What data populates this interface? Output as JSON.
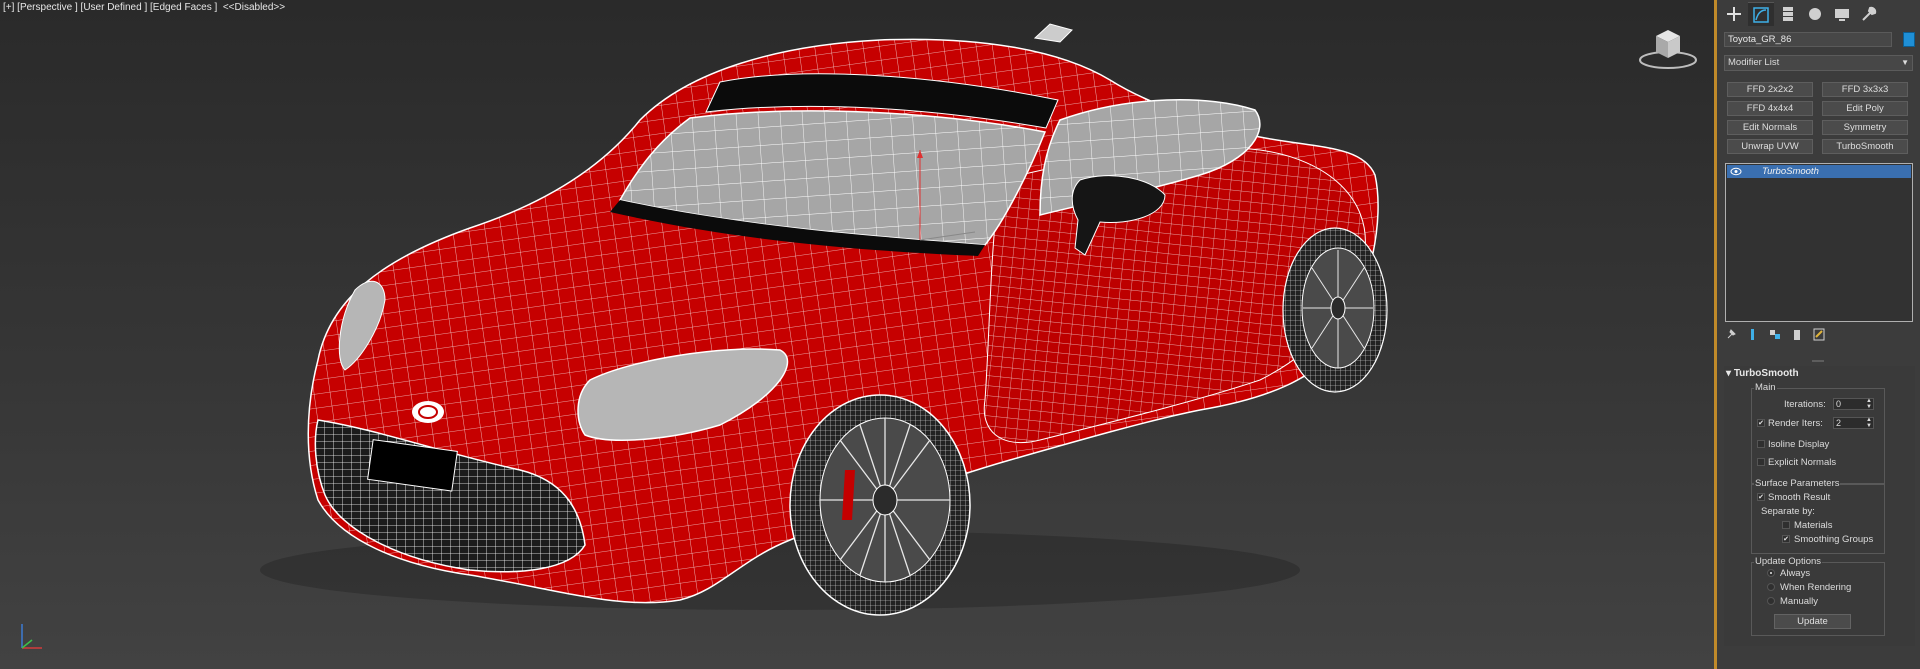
{
  "viewport": {
    "label": "[+] [Perspective ] [User Defined ] [Edged Faces ]  <<Disabled>>",
    "axis_labels": {
      "x": "x",
      "y": "y",
      "z": "z"
    }
  },
  "command_panel": {
    "tabs": [
      {
        "icon": "create-icon"
      },
      {
        "icon": "modify-icon"
      },
      {
        "icon": "hierarchy-icon"
      },
      {
        "icon": "motion-icon"
      },
      {
        "icon": "display-icon"
      },
      {
        "icon": "utilities-icon"
      }
    ],
    "object_name": "Toyota_GR_86",
    "object_color": "#1f8fd6",
    "modifier_list": "Modifier List",
    "modifier_buttons": [
      "FFD 2x2x2",
      "FFD 3x3x3",
      "FFD 4x4x4",
      "Edit Poly",
      "Edit Normals",
      "Symmetry",
      "Unwrap UVW",
      "TurboSmooth"
    ],
    "stack": {
      "selected": "TurboSmooth"
    },
    "stack_toolbar": [
      "pin-stack-icon",
      "show-end-result-icon",
      "make-unique-icon",
      "remove-modifier-icon",
      "configure-sets-icon"
    ],
    "turbosmooth": {
      "title": "TurboSmooth",
      "main": {
        "title": "Main",
        "iterations_label": "Iterations:",
        "iterations": "0",
        "render_iters_label": "Render Iters:",
        "render_iters": "2",
        "render_iters_checked": true,
        "isoline_display": "Isoline Display",
        "isoline_checked": false,
        "explicit_normals": "Explicit Normals",
        "explicit_checked": false
      },
      "surface": {
        "title": "Surface Parameters",
        "smooth_result": "Smooth Result",
        "smooth_checked": true,
        "separate_by": "Separate by:",
        "materials": "Materials",
        "materials_checked": false,
        "smoothing_groups": "Smoothing Groups",
        "smoothing_checked": true
      },
      "update": {
        "title": "Update Options",
        "always": "Always",
        "when_rendering": "When Rendering",
        "manually": "Manually",
        "selected": "Always",
        "button": "Update"
      }
    }
  },
  "colors": {
    "accent_separator": "#c08a2a",
    "selection": "#3a6fb0",
    "car_body": "#c40000"
  }
}
